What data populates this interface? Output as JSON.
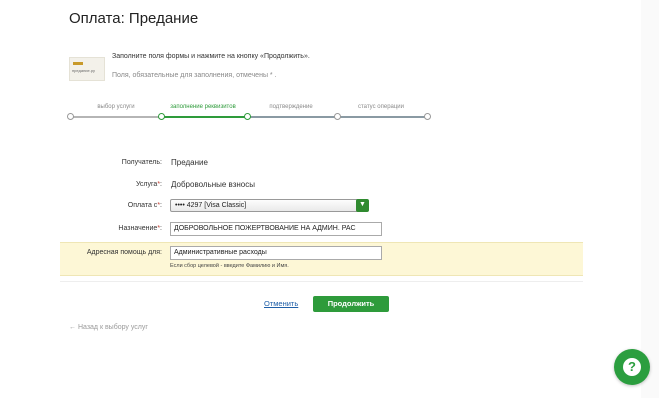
{
  "title": "Оплата: Предание",
  "logo": {
    "text": "предание.ру"
  },
  "instruction": "Заполните поля формы и нажмите на кнопку «Продолжить».",
  "required_note": "Поля, обязательные для заполнения, отмечены * .",
  "progress": {
    "steps": [
      "выбор услуги",
      "заполнение реквизитов",
      "подтверждение",
      "статус операции"
    ],
    "active_index": 1
  },
  "form": {
    "recipient": {
      "label": "Получатель:",
      "value": "Предание"
    },
    "service": {
      "label": "Услуга",
      "required_mark": "*",
      "colon": ":",
      "value": "Добровольные взносы"
    },
    "payment_from": {
      "label": "Оплата с",
      "required_mark": "*",
      "colon": ":",
      "value": "•••• 4297 [Visa Classic]"
    },
    "purpose": {
      "label": "Назначение",
      "required_mark": "*",
      "colon": ":",
      "value": "ДОБРОВОЛЬНОЕ ПОЖЕРТВОВАНИЕ НА АДМИН. РАС"
    },
    "targeted_help": {
      "label": "Адресная помощь для:",
      "value": "Административные расходы",
      "hint": "Если сбор целевой - введите Фамилию и Имя."
    }
  },
  "actions": {
    "cancel": "Отменить",
    "submit": "Продолжить"
  },
  "back_link": "← Назад к выбору услуг",
  "help_button": {
    "glyph": "?"
  },
  "colors": {
    "accent": "#2e9b3b",
    "link": "#1f5fa8",
    "highlight": "#fdf7d6"
  }
}
